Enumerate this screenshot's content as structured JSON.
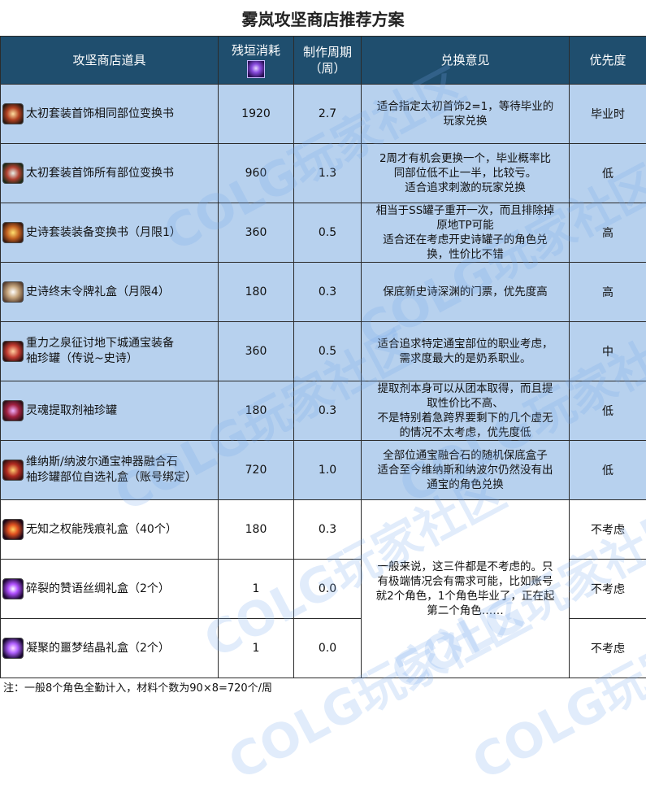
{
  "title": "雾岚攻坚商店推荐方案",
  "header": {
    "item": "攻坚商店道具",
    "cost": "残垣消耗",
    "cost_icon": "purple-crystal-icon",
    "period_line1": "制作周期",
    "period_line2": "（周）",
    "advice": "兑换意见",
    "priority": "优先度"
  },
  "rows": [
    {
      "name": "太初套装首饰相同部位变换书",
      "icon": "exchange-book-icon",
      "cost": "1920",
      "period": "2.7",
      "advice": [
        "适合指定太初首饰2=1，等待毕业的",
        "玩家兑换"
      ],
      "priority": "毕业时"
    },
    {
      "name": "太初套装首饰所有部位变换书",
      "icon": "exchange-book-icon",
      "cost": "960",
      "period": "1.3",
      "advice": [
        "2周才有机会更换一个，毕业概率比",
        "同部位低不止一半，比较亏。",
        "适合追求刺激的玩家兑换"
      ],
      "priority": "低"
    },
    {
      "name": "史诗套装装备变换书（月限1）",
      "icon": "epic-book-icon",
      "cost": "360",
      "period": "0.5",
      "advice": [
        "相当于SS罐子重开一次，而且排除掉",
        "原地TP可能",
        "适合还在考虑开史诗罐子的角色兑",
        "换，性价比不错"
      ],
      "priority": "高"
    },
    {
      "name": "史诗终末令牌礼盒（月限4）",
      "icon": "token-box-icon",
      "cost": "180",
      "period": "0.3",
      "advice": [
        "保底新史诗深渊的门票，优先度高"
      ],
      "priority": "高"
    },
    {
      "name": "重力之泉征讨地下城通宝装备袖珍罐（传说~史诗）",
      "name_lines": [
        "重力之泉征讨地下城通宝装备",
        "袖珍罐（传说~史诗）"
      ],
      "icon": "jar-icon",
      "cost": "360",
      "period": "0.5",
      "advice": [
        "适合追求特定通宝部位的职业考虑，",
        "需求度最大的是奶系职业。"
      ],
      "priority": "中"
    },
    {
      "name": "灵魂提取剂袖珍罐",
      "icon": "soul-jar-icon",
      "cost": "180",
      "period": "0.3",
      "advice": [
        "提取剂本身可以从团本取得，而且提",
        "取性价比不高、",
        "不是特别着急跨界要剩下的几个虚无",
        "的情况不太考虑，优先度低"
      ],
      "priority": "低"
    },
    {
      "name": "维纳斯/纳波尔通宝神器融合石袖珍罐部位自选礼盒（账号绑定）",
      "name_lines": [
        "维纳斯/纳波尔通宝神器融合石",
        "袖珍罐部位自选礼盒（账号绑定）"
      ],
      "icon": "fusion-stone-box-icon",
      "cost": "720",
      "period": "1.0",
      "advice": [
        "全部位通宝融合石的随机保底盒子",
        "适合至今维纳斯和纳波尔仍然没有出",
        "通宝的角色兑换"
      ],
      "priority": "低"
    },
    {
      "name": "无知之权能残痕礼盒（40个）",
      "icon": "fire-orb-icon",
      "cost": "180",
      "period": "0.3",
      "advice": [],
      "priority": "不考虑"
    },
    {
      "name": "碎裂的赞语丝绸礼盒（2个）",
      "icon": "silk-box-icon",
      "cost": "1",
      "period": "0.0",
      "advice": [
        "一般来说，这三件都是不考虑的。只",
        "有极端情况会有需求可能，比如账号",
        "就2个角色，1个角色毕业了，正在起",
        "第二个角色……"
      ],
      "priority": "不考虑"
    },
    {
      "name": "凝聚的噩梦结晶礼盒（2个）",
      "icon": "nightmare-crystal-icon",
      "cost": "1",
      "period": "0.0",
      "advice": [],
      "priority": "不考虑"
    }
  ],
  "note": "注：一般8个角色全勤计入，材料个数为90×8=720个/周",
  "watermark": "COLG玩家社区",
  "colors": {
    "header_bg": "#1f4e6e",
    "row_blue": "#b7d1ee",
    "row_white": "#ffffff"
  }
}
